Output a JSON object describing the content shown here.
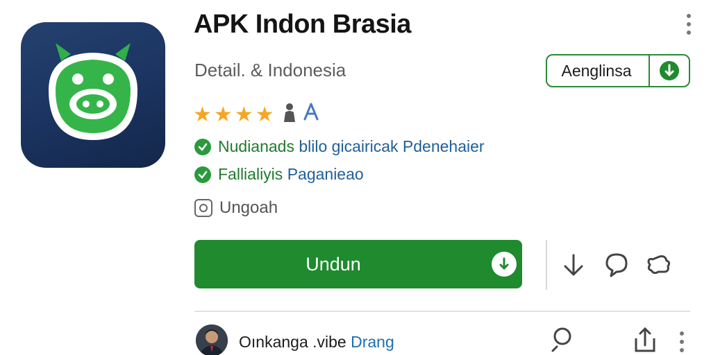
{
  "app": {
    "title": "APK Indon Brasia",
    "subtitle": "Detail. & Indonesia",
    "icon": "green-mascot-app-icon"
  },
  "language_button": {
    "label": "Aenglinsa",
    "icon": "download-circle-icon"
  },
  "rating": {
    "stars": 4,
    "max_stars": 5,
    "extra": "🙋",
    "extra2": "Ʌ"
  },
  "features": [
    {
      "text_green": "Nudianads",
      "text_blue": "blilo gicairicak Pdenehaier"
    },
    {
      "text_green": "Fallialiyis",
      "text_blue": "Paganieao"
    }
  ],
  "misc": {
    "label": "Ungoah",
    "icon": "shield-icon"
  },
  "download_button": {
    "label": "Undun",
    "icon": "download-arrow-icon"
  },
  "actions": [
    {
      "name": "download-arrow-icon"
    },
    {
      "name": "chat-bubble-icon"
    },
    {
      "name": "puzzle-share-icon"
    }
  ],
  "footer": {
    "text_dark": "Oınkanga .vibe",
    "text_blue": "Drang"
  },
  "colors": {
    "brand_green": "#1f8a2e",
    "accent_blue": "#1f5f9a",
    "star": "#f5a623",
    "icon_bg": "#1b3360"
  }
}
